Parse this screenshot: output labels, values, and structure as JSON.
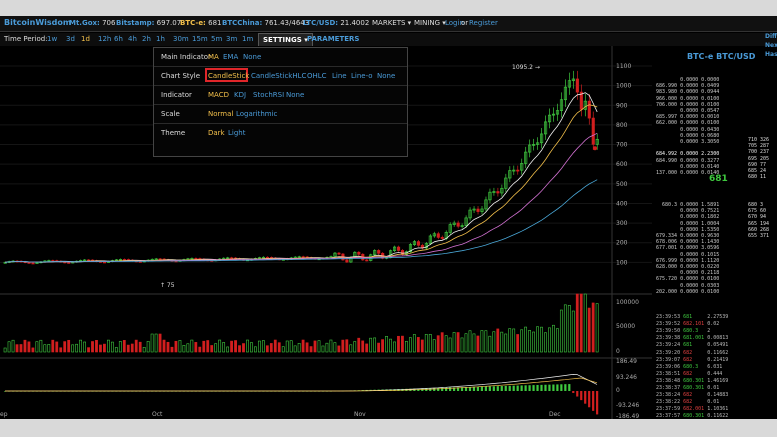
{
  "topbar": {
    "brand": "BitcoinWisdom",
    "tickers": [
      {
        "label": "Mt.Gox:",
        "value": "706"
      },
      {
        "label": "Bitstamp:",
        "value": "697.07"
      },
      {
        "label": "BTC-e:",
        "value": "681"
      },
      {
        "label": "BTCChina:",
        "value": "761.43/4643"
      },
      {
        "label": "LTC/USD:",
        "value": "21.4002"
      }
    ],
    "markets": "MARKETS ▾",
    "mining": "MINING ▾",
    "login": "Login",
    "or": "or",
    "register": "Register"
  },
  "toolbar": {
    "time_period_label": "Time Period:",
    "periods": [
      "1w",
      "3d",
      "1d",
      "12h",
      "6h",
      "4h",
      "2h",
      "1h",
      "30m",
      "15m",
      "5m",
      "3m",
      "1m"
    ],
    "active_period": "1d",
    "settings_tab": "SETTINGS ▾",
    "parameters_tab": "PARAMETERS"
  },
  "settings_panel": {
    "rows": [
      {
        "label": "Main Indicator",
        "options": [
          "MA",
          "EMA",
          "None"
        ],
        "selected": "MA"
      },
      {
        "label": "Chart Style",
        "options": [
          "CandleStick",
          "CandleStickHLC",
          "OHLC",
          "Line",
          "Line-o",
          "None"
        ],
        "selected": "CandleStick"
      },
      {
        "label": "Indicator",
        "options": [
          "MACD",
          "KDJ",
          "StochRSI",
          "None"
        ],
        "selected": "MACD"
      },
      {
        "label": "Scale",
        "options": [
          "Normal",
          "Logarithmic"
        ],
        "selected": "Normal"
      },
      {
        "label": "Theme",
        "options": [
          "Dark",
          "Light"
        ],
        "selected": "Dark"
      }
    ]
  },
  "chart": {
    "high_label": "1095.2",
    "low_label": "75",
    "price_axis": [
      "1100",
      "1000",
      "900",
      "800",
      "700",
      "600",
      "500",
      "400",
      "300",
      "200",
      "100"
    ],
    "volume_axis": [
      "100000",
      "50000",
      "0"
    ],
    "macd_axis": [
      "186.49",
      "93.246",
      "0",
      "-93.246",
      "-186.49"
    ],
    "x_labels": [
      "ep",
      "Oct",
      "Nov",
      "Dec"
    ],
    "colors": {
      "up": "#3fc83f",
      "down": "#d21f1f",
      "ma1": "#f0f0f0",
      "ma2": "#f3c04b",
      "ma3": "#d070d0",
      "ma4": "#4aa8d8"
    }
  },
  "orderbook": {
    "title": "BTC-e BTC/USD",
    "asks": [
      [
        "",
        "0.0000",
        "0.0000"
      ],
      [
        "686.990",
        "0.0000",
        "0.0409"
      ],
      [
        "983.980",
        "0.0000",
        "0.0944"
      ],
      [
        "966.000",
        "0.0000",
        "0.0100"
      ],
      [
        "706.000",
        "0.0000",
        "0.0100"
      ],
      [
        "",
        "0.0000",
        "0.0547"
      ],
      [
        "685.997",
        "0.0000",
        "0.0010"
      ],
      [
        "662.000",
        "0.0000",
        "0.0100"
      ],
      [
        "",
        "0.0000",
        "0.0430"
      ],
      [
        "",
        "0.0000",
        "0.0680"
      ],
      [
        "",
        "0.0000",
        "3.3050"
      ],
      [
        "",
        "",
        ""
      ],
      [
        "684.992",
        "0.0000",
        "2.2300"
      ],
      [
        "684.990",
        "0.0000",
        "0.3277"
      ],
      [
        "",
        "0.0000",
        "0.0140"
      ],
      [
        "137.000",
        "0.0000",
        "0.0140"
      ]
    ],
    "ask_sums": [
      "710 326",
      "705 287",
      "700 237",
      "695 205",
      "690 77",
      "685 24",
      "680 11"
    ],
    "last_price": "681",
    "bids": [
      [
        "680.3",
        "0.0000",
        "1.5891"
      ],
      [
        "",
        "0.0000",
        "0.7521"
      ],
      [
        "",
        "0.0000",
        "0.1802"
      ],
      [
        "",
        "0.0000",
        "1.0004"
      ],
      [
        "",
        "0.0000",
        "1.5350"
      ],
      [
        "679.334",
        "0.0000",
        "0.9630"
      ],
      [
        "678.006",
        "0.0000",
        "1.1430"
      ],
      [
        "677.001",
        "0.0000",
        "3.0596"
      ],
      [
        "",
        "0.0000",
        "0.1015"
      ],
      [
        "676.999",
        "0.0000",
        "1.1120"
      ],
      [
        "628.000",
        "0.0000",
        "0.0220"
      ],
      [
        "",
        "0.0000",
        "0.2118"
      ],
      [
        "675.720",
        "0.0000",
        "0.0100"
      ],
      [
        "",
        "0.0000",
        "0.0303"
      ],
      [
        "202.000",
        "0.0000",
        "0.0100"
      ]
    ],
    "bid_sums": [
      "680 3",
      "675 60",
      "670 94",
      "665 194",
      "660 268",
      "655 371"
    ],
    "trades": [
      [
        "23:39:53",
        "681",
        "2.27539"
      ],
      [
        "23:39:52",
        "682.101",
        "0.02"
      ],
      [
        "23:39:50",
        "680.3",
        "2"
      ],
      [
        "23:39:38",
        "681.001",
        "0.00813"
      ],
      [
        "23:39:24",
        "681",
        "0.05491"
      ],
      [
        "23:39:20",
        "682",
        "0.11662"
      ],
      [
        "23:39:07",
        "682",
        "0.21419"
      ],
      [
        "23:39:06",
        "680.3",
        "6.031"
      ],
      [
        "23:38:51",
        "682",
        "0.444"
      ],
      [
        "23:38:48",
        "680.301",
        "1.46169"
      ],
      [
        "23:38:37",
        "680.301",
        "0.01"
      ],
      [
        "23:38:24",
        "682",
        "0.14883"
      ],
      [
        "23:38:22",
        "682",
        "0.01"
      ],
      [
        "23:37:59",
        "682.001",
        "1.10361"
      ],
      [
        "23:37:57",
        "680.301",
        "0.11622"
      ]
    ]
  },
  "sidecut": [
    "Diff",
    "Nex",
    "Has"
  ]
}
